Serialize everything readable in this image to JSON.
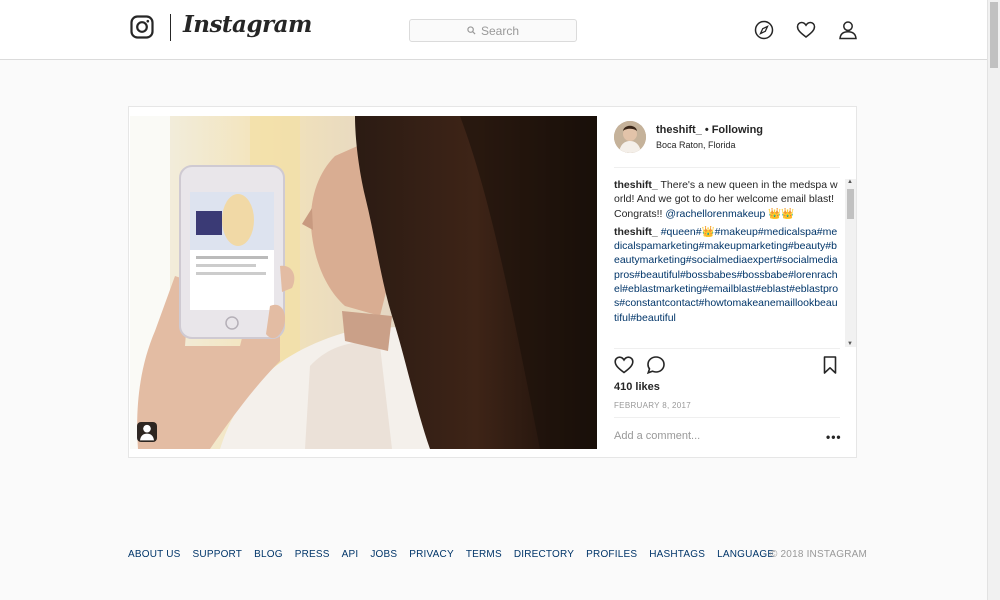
{
  "header": {
    "wordmark": "Instagram",
    "search_placeholder": "Search"
  },
  "post": {
    "username": "theshift_",
    "following_label": "Following",
    "location": "Boca Raton, Florida",
    "caption_user": "theshift_",
    "caption_text": "There's a new queen in the medspa world! And we got to do her welcome email blast! Congrats!!",
    "caption_mention": "@rachellorenmakeup 👑👑",
    "comment_user": "theshift_",
    "comment_text": "#queen#👑#makeup#medicalspa#medicalspamarketing#makeupmarketing#beauty#beautymarketing#socialmediaexpert#socialmediapros#beautiful#bossbabes#bossbabe#lorenrachel#eblastmarketing#emailblast#eblast#eblastpros#constantcontact#howtomakeanemaillookbeautiful#beautiful",
    "likes": "410 likes",
    "date": "FEBRUARY 8, 2017",
    "add_comment_placeholder": "Add a comment...",
    "more_label": "•••"
  },
  "footer": {
    "links": [
      "ABOUT US",
      "SUPPORT",
      "BLOG",
      "PRESS",
      "API",
      "JOBS",
      "PRIVACY",
      "TERMS",
      "DIRECTORY",
      "PROFILES",
      "HASHTAGS",
      "LANGUAGE"
    ],
    "copyright": "© 2018 INSTAGRAM"
  },
  "icons": {
    "logo": "instagram-glyph-icon",
    "search": "search-icon",
    "explore": "compass-icon",
    "activity": "heart-icon",
    "profile": "person-icon",
    "like": "heart-outline-icon",
    "comment": "comment-bubble-icon",
    "save": "bookmark-icon",
    "tagged": "user-tag-icon"
  }
}
